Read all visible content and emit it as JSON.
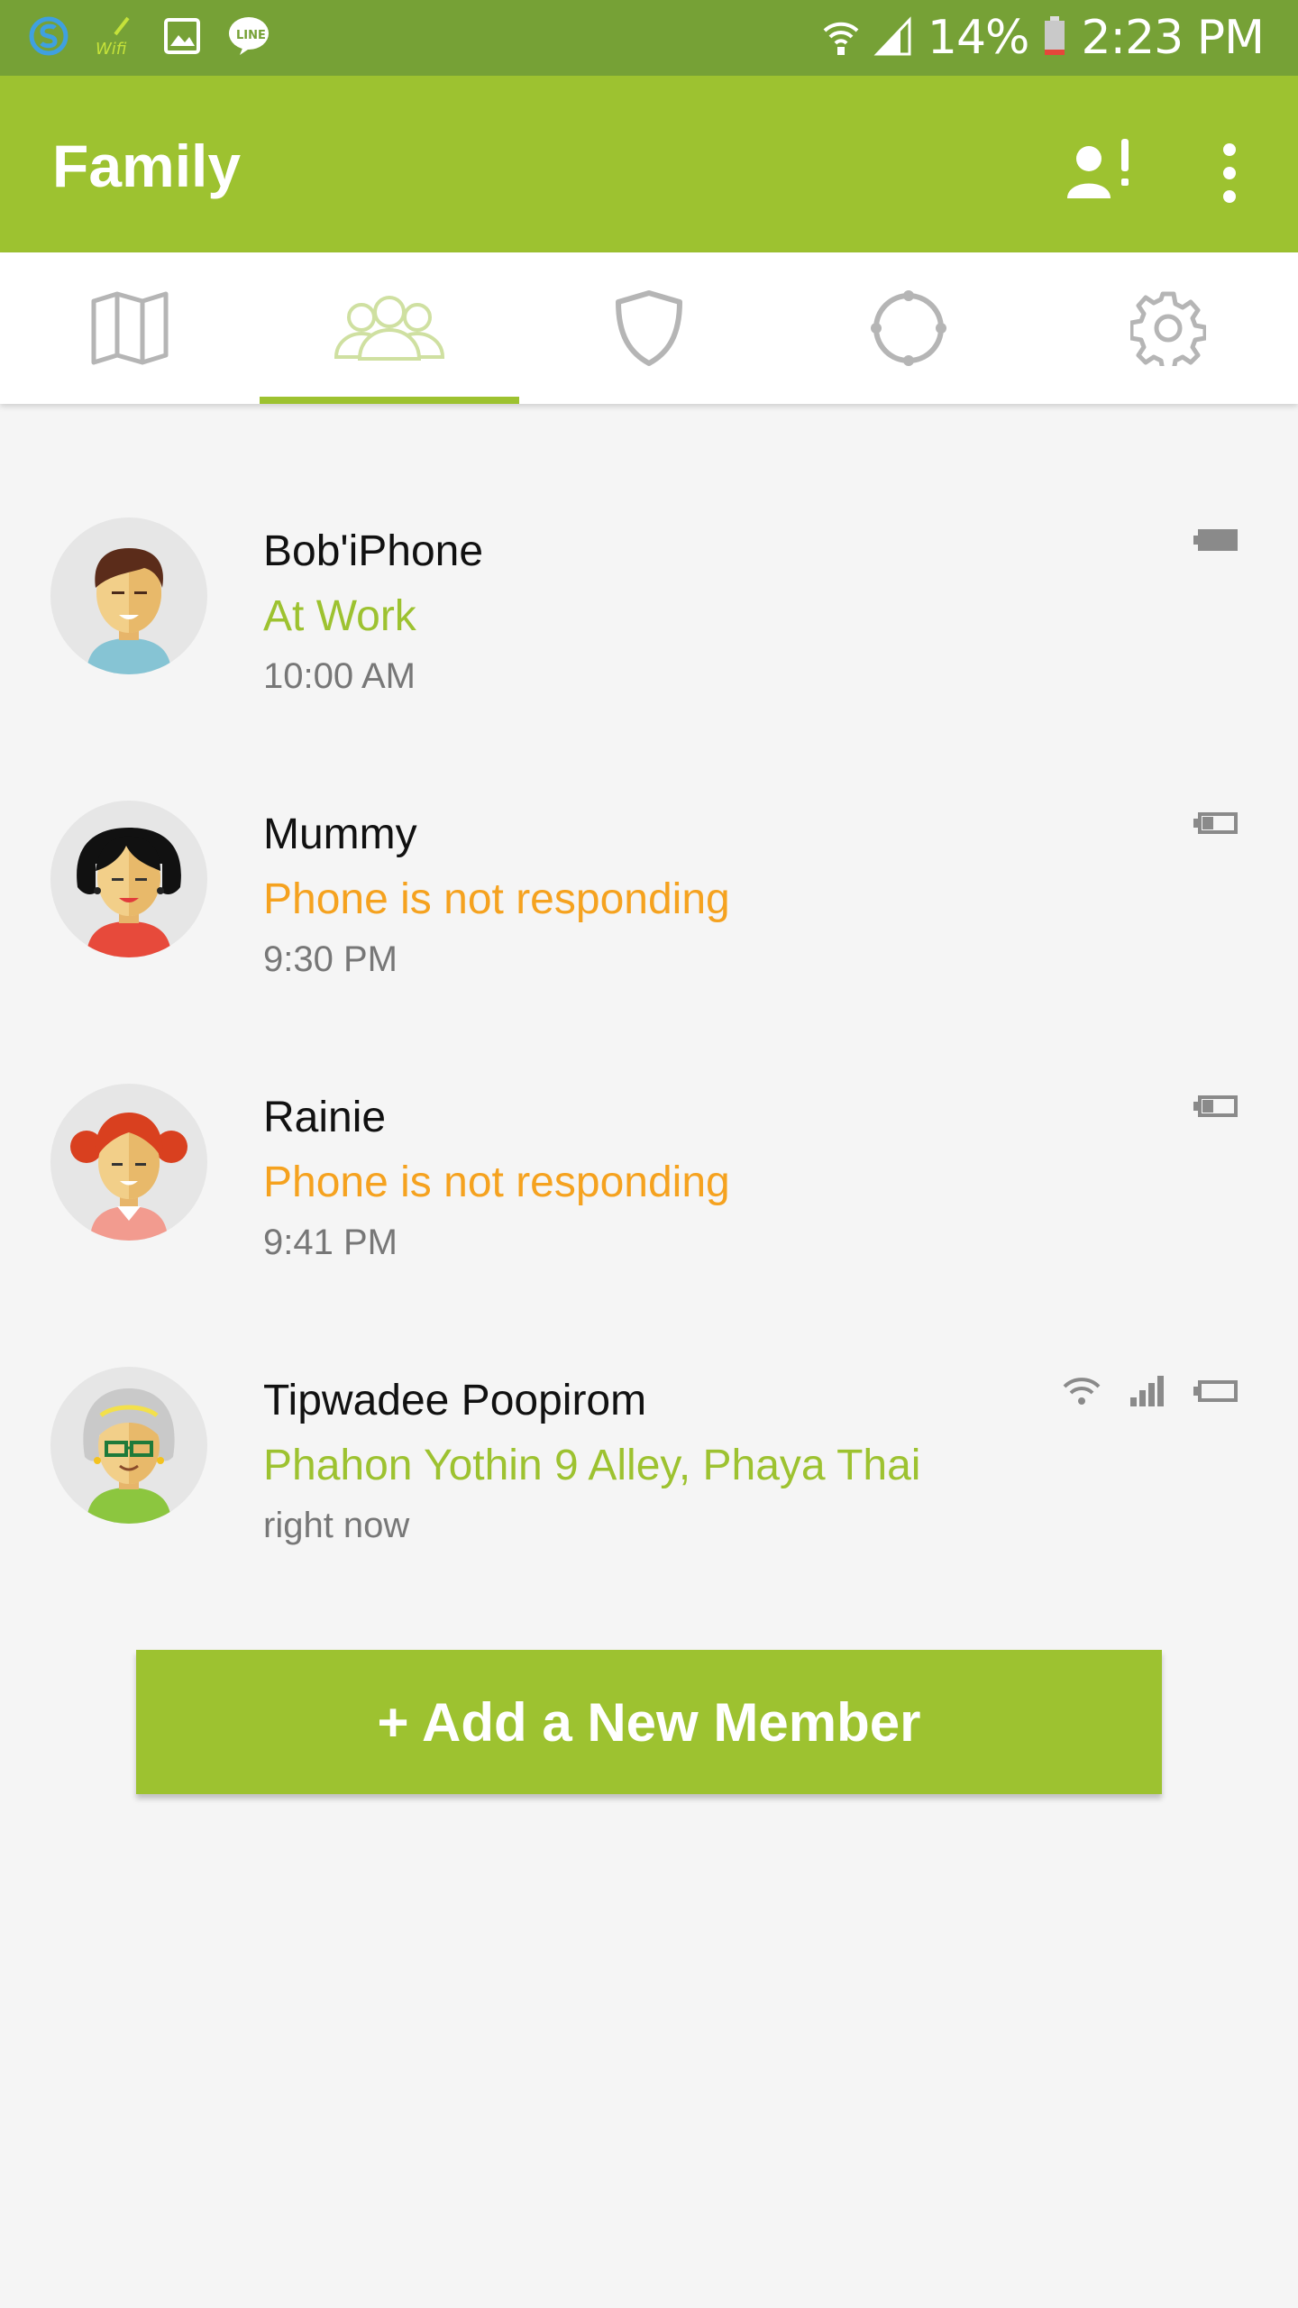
{
  "status_bar": {
    "battery_text": "14%",
    "time": "2:23 PM",
    "left_icons": [
      "skype-icon",
      "wifi-app-icon",
      "gallery-icon",
      "line-icon"
    ],
    "wifi_label": "Wifi",
    "line_label": "LINE"
  },
  "app_bar": {
    "title": "Family"
  },
  "tabs": [
    {
      "name": "map",
      "icon": "map-icon",
      "active": false
    },
    {
      "name": "family",
      "icon": "people-icon",
      "active": true
    },
    {
      "name": "safety",
      "icon": "shield-icon",
      "active": false
    },
    {
      "name": "places",
      "icon": "target-icon",
      "active": false
    },
    {
      "name": "settings",
      "icon": "gear-icon",
      "active": false
    }
  ],
  "members": [
    {
      "name": "Bob'iPhone",
      "status": "At Work",
      "status_kind": "ok",
      "time": "10:00 AM"
    },
    {
      "name": "Mummy",
      "status": "Phone is not responding",
      "status_kind": "warn",
      "time": "9:30 PM"
    },
    {
      "name": "Rainie",
      "status": "Phone is not responding",
      "status_kind": "warn",
      "time": "9:41 PM"
    },
    {
      "name": "Tipwadee Poopirom",
      "status": "Phahon Yothin 9 Alley, Phaya Thai",
      "status_kind": "ok",
      "time": "right now"
    }
  ],
  "add_button_label": "+ Add a New Member",
  "colors": {
    "status_bar": "#76a136",
    "primary": "#9dc230",
    "warning": "#f5a21f",
    "icon_gray": "#b5b5b5"
  }
}
